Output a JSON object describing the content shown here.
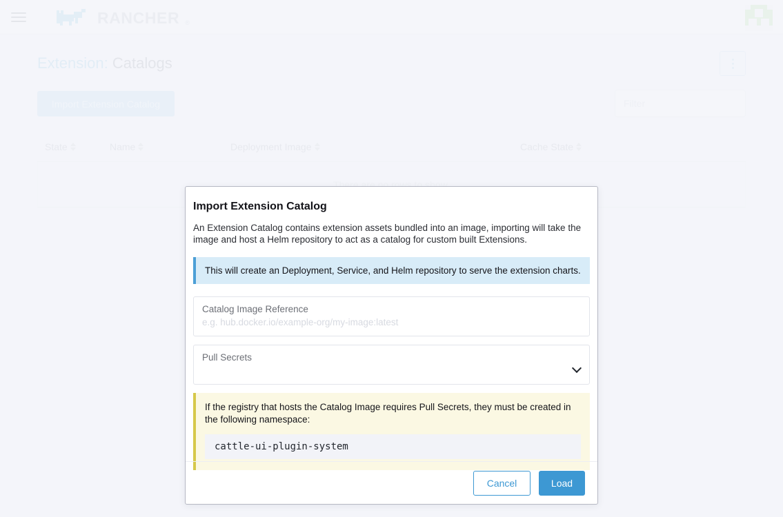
{
  "topnav": {
    "menu_icon": "hamburger-icon",
    "brand": "RANCHER",
    "brand_reg": "®",
    "cluster_icon": "cluster-icon"
  },
  "page": {
    "title_prefix": "Extension:",
    "title_main": "Catalogs",
    "actions_menu_icon": "kebab-menu-icon",
    "import_button": "Import Extension Catalog",
    "filter_placeholder": "Filter",
    "table": {
      "columns": [
        {
          "label": "State",
          "sortable": true
        },
        {
          "label": "Name",
          "sortable": true
        },
        {
          "label": "Deployment Image",
          "sortable": true
        },
        {
          "label": "Cache State",
          "sortable": true
        }
      ],
      "empty_message": "There are no rows to show."
    }
  },
  "modal": {
    "title": "Import Extension Catalog",
    "description": "An Extension Catalog contains extension assets bundled into an image, importing will take the image and host a Helm repository to act as a catalog for custom built Extensions.",
    "info_banner": "This will create an Deployment, Service, and Helm repository to serve the extension charts.",
    "image_field": {
      "label": "Catalog Image Reference",
      "placeholder": "e.g. hub.docker.io/example-org/my-image:latest",
      "value": ""
    },
    "pull_secrets_field": {
      "label": "Pull Secrets",
      "value": "",
      "chevron_icon": "chevron-down-icon"
    },
    "warning_banner": {
      "text": "If the registry that hosts the Catalog Image requires Pull Secrets, they must be created in the following namespace:",
      "namespace": "cattle-ui-plugin-system"
    },
    "cancel_button": "Cancel",
    "load_button": "Load"
  },
  "colors": {
    "accent_blue": "#3d98d3",
    "info_banner_bg": "#d8ecf8",
    "info_banner_border": "#4c9fd6",
    "warning_bg": "#fbf8e3",
    "warning_border": "#d6c84a",
    "brand_blue": "#b6d9ed",
    "cluster_green": "#cdeac4",
    "page_bg": "#f4f5fa"
  }
}
